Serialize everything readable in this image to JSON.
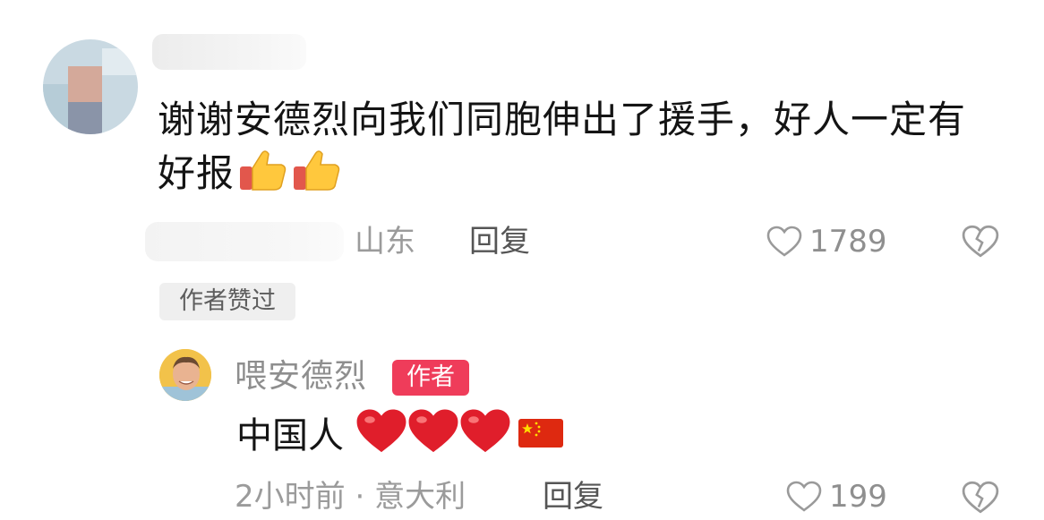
{
  "comment": {
    "text": "谢谢安德烈向我们同胞伸出了援手，好人一定有好报",
    "location": "山东",
    "reply_label": "回复",
    "like_count": "1789",
    "author_liked_label": "作者赞过",
    "emoji": [
      "thumbs-up",
      "thumbs-up"
    ]
  },
  "reply": {
    "username": "喂安德烈",
    "badge": "作者",
    "text": "中国人",
    "emoji": [
      "red-heart",
      "red-heart",
      "red-heart",
      "china-flag"
    ],
    "time": "2小时前",
    "separator": "·",
    "location": "意大利",
    "reply_label": "回复",
    "like_count": "199"
  },
  "icons": [
    "like-heart-icon",
    "dislike-broken-heart-icon"
  ],
  "colors": {
    "badge": "#ef3c5a",
    "heart": "#e01e2b",
    "meta_text": "#9b9b9b"
  }
}
